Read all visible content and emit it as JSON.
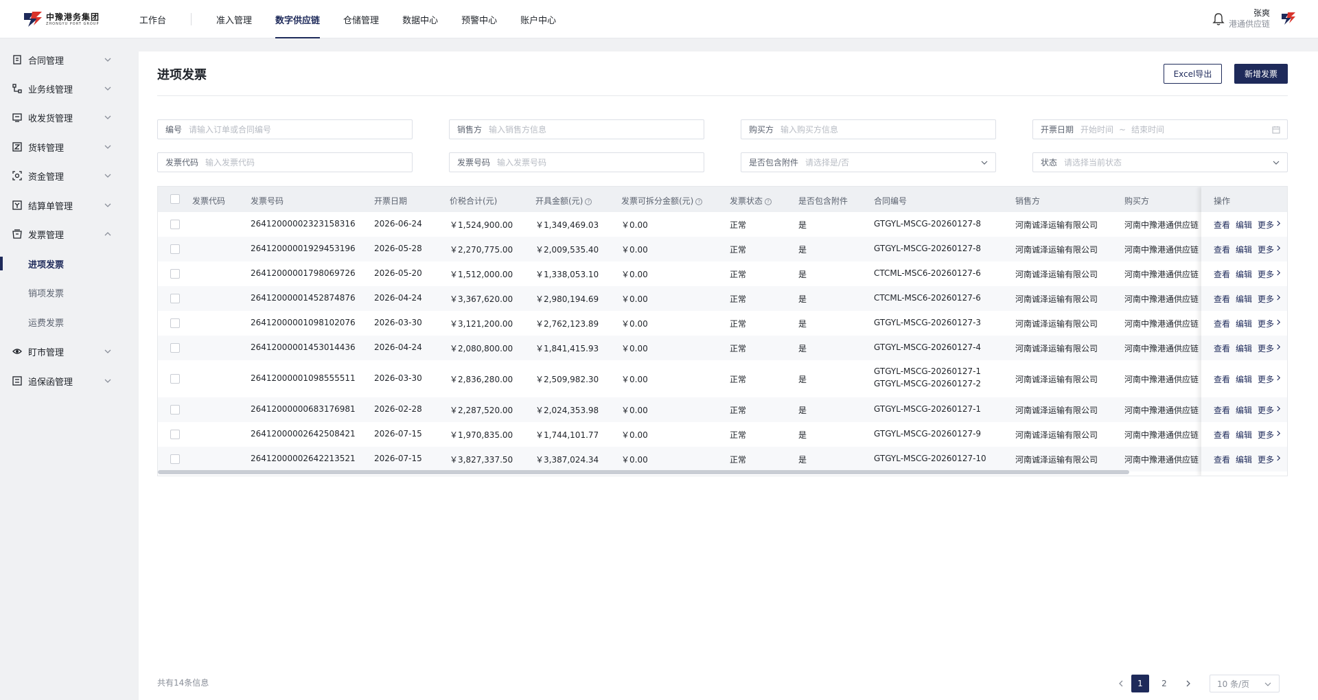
{
  "header": {
    "logo_cn": "中豫港务集团",
    "logo_en": "ZHONGYU PORT GROUP",
    "nav": [
      {
        "label": "工作台"
      },
      {
        "label": "准入管理"
      },
      {
        "label": "数字供应链"
      },
      {
        "label": "仓储管理"
      },
      {
        "label": "数据中心"
      },
      {
        "label": "预警中心"
      },
      {
        "label": "账户中心"
      }
    ],
    "active_nav": "数字供应链",
    "user_name": "张爽",
    "user_org": "港通供应链"
  },
  "sidebar": {
    "items": [
      {
        "label": "合同管理",
        "icon": "contract-icon"
      },
      {
        "label": "业务线管理",
        "icon": "flow-icon"
      },
      {
        "label": "收发货管理",
        "icon": "shipping-icon"
      },
      {
        "label": "货转管理",
        "icon": "transfer-icon"
      },
      {
        "label": "资金管理",
        "icon": "fund-icon"
      },
      {
        "label": "结算单管理",
        "icon": "settlement-icon"
      },
      {
        "label": "发票管理",
        "icon": "invoice-icon"
      },
      {
        "label": "盯市管理",
        "icon": "eye-icon"
      },
      {
        "label": "追保函管理",
        "icon": "guarantee-icon"
      }
    ],
    "sub_items": [
      {
        "label": "进项发票"
      },
      {
        "label": "销项发票"
      },
      {
        "label": "运费发票"
      }
    ],
    "active_sub": "进项发票"
  },
  "page": {
    "title": "进项发票",
    "export_label": "Excel导出",
    "add_label": "新增发票"
  },
  "filters": {
    "code": {
      "label": "编号",
      "placeholder": "请输入订单或合同编号"
    },
    "seller": {
      "label": "销售方",
      "placeholder": "输入销售方信息"
    },
    "buyer": {
      "label": "购买方",
      "placeholder": "输入购买方信息"
    },
    "date": {
      "label": "开票日期",
      "start": "开始时间",
      "sep": "~",
      "end": "结束时间"
    },
    "invoice_code": {
      "label": "发票代码",
      "placeholder": "输入发票代码"
    },
    "invoice_no": {
      "label": "发票号码",
      "placeholder": "输入发票号码"
    },
    "attachment": {
      "label": "是否包含附件",
      "placeholder": "请选择是/否"
    },
    "status": {
      "label": "状态",
      "placeholder": "请选择当前状态"
    }
  },
  "table": {
    "headers": {
      "code": "发票代码",
      "no": "发票号码",
      "date": "开票日期",
      "total": "价税合计(元)",
      "amount": "开具金额(元)",
      "splittable": "发票可拆分金额(元)",
      "status": "发票状态",
      "attachment": "是否包含附件",
      "contract": "合同编号",
      "seller": "销售方",
      "buyer": "购买方",
      "ops": "操作"
    },
    "rows": [
      {
        "no": "26412000002323158316",
        "date": "2026-06-24",
        "total": "￥1,524,900.00",
        "amount": "￥1,349,469.03",
        "split": "￥0.00",
        "status": "正常",
        "att": "是",
        "contract": [
          "GTGYL-MSCG-20260127-8"
        ],
        "seller": "河南诚泽运输有限公司",
        "buyer": "河南中豫港通供应链"
      },
      {
        "no": "26412000001929453196",
        "date": "2026-05-28",
        "total": "￥2,270,775.00",
        "amount": "￥2,009,535.40",
        "split": "￥0.00",
        "status": "正常",
        "att": "是",
        "contract": [
          "GTGYL-MSCG-20260127-8"
        ],
        "seller": "河南诚泽运输有限公司",
        "buyer": "河南中豫港通供应链"
      },
      {
        "no": "26412000001798069726",
        "date": "2026-05-20",
        "total": "￥1,512,000.00",
        "amount": "￥1,338,053.10",
        "split": "￥0.00",
        "status": "正常",
        "att": "是",
        "contract": [
          "CTCML-MSC6-20260127-6"
        ],
        "seller": "河南诚泽运输有限公司",
        "buyer": "河南中豫港通供应链"
      },
      {
        "no": "26412000001452874876",
        "date": "2026-04-24",
        "total": "￥3,367,620.00",
        "amount": "￥2,980,194.69",
        "split": "￥0.00",
        "status": "正常",
        "att": "是",
        "contract": [
          "CTCML-MSC6-20260127-6"
        ],
        "seller": "河南诚泽运输有限公司",
        "buyer": "河南中豫港通供应链"
      },
      {
        "no": "26412000001098102076",
        "date": "2026-03-30",
        "total": "￥3,121,200.00",
        "amount": "￥2,762,123.89",
        "split": "￥0.00",
        "status": "正常",
        "att": "是",
        "contract": [
          "GTGYL-MSCG-20260127-3"
        ],
        "seller": "河南诚泽运输有限公司",
        "buyer": "河南中豫港通供应链"
      },
      {
        "no": "26412000001453014436",
        "date": "2026-04-24",
        "total": "￥2,080,800.00",
        "amount": "￥1,841,415.93",
        "split": "￥0.00",
        "status": "正常",
        "att": "是",
        "contract": [
          "GTGYL-MSCG-20260127-4"
        ],
        "seller": "河南诚泽运输有限公司",
        "buyer": "河南中豫港通供应链"
      },
      {
        "no": "26412000001098555511",
        "date": "2026-03-30",
        "total": "￥2,836,280.00",
        "amount": "￥2,509,982.30",
        "split": "￥0.00",
        "status": "正常",
        "att": "是",
        "contract": [
          "GTGYL-MSCG-20260127-1",
          "GTGYL-MSCG-20260127-2"
        ],
        "seller": "河南诚泽运输有限公司",
        "buyer": "河南中豫港通供应链"
      },
      {
        "no": "26412000000683176981",
        "date": "2026-02-28",
        "total": "￥2,287,520.00",
        "amount": "￥2,024,353.98",
        "split": "￥0.00",
        "status": "正常",
        "att": "是",
        "contract": [
          "GTGYL-MSCG-20260127-1"
        ],
        "seller": "河南诚泽运输有限公司",
        "buyer": "河南中豫港通供应链"
      },
      {
        "no": "26412000002642508421",
        "date": "2026-07-15",
        "total": "￥1,970,835.00",
        "amount": "￥1,744,101.77",
        "split": "￥0.00",
        "status": "正常",
        "att": "是",
        "contract": [
          "GTGYL-MSCG-20260127-9"
        ],
        "seller": "河南诚泽运输有限公司",
        "buyer": "河南中豫港通供应链"
      },
      {
        "no": "26412000002642213521",
        "date": "2026-07-15",
        "total": "￥3,827,337.50",
        "amount": "￥3,387,024.34",
        "split": "￥0.00",
        "status": "正常",
        "att": "是",
        "contract": [
          "GTGYL-MSCG-20260127-10"
        ],
        "seller": "河南诚泽运输有限公司",
        "buyer": "河南中豫港通供应链"
      }
    ],
    "ops": {
      "view": "查看",
      "edit": "编辑",
      "more": "更多"
    }
  },
  "footer": {
    "total_text": "共有14条信息",
    "pages": [
      "1",
      "2"
    ],
    "current_page": "1",
    "page_size": "10 条/页"
  },
  "colors": {
    "accent": "#1e2a5a",
    "logo_red": "#d9332b",
    "logo_navy": "#1e2a5a"
  }
}
